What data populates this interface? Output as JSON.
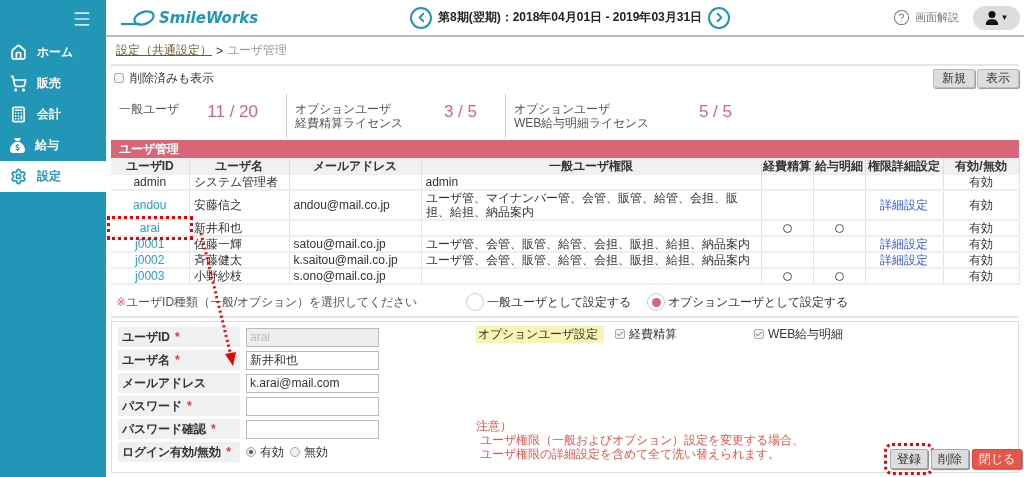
{
  "sidebar": {
    "items": [
      {
        "label": "ホーム",
        "selected": false
      },
      {
        "label": "販売",
        "selected": false
      },
      {
        "label": "会計",
        "selected": false
      },
      {
        "label": "給与",
        "selected": false
      },
      {
        "label": "設定",
        "selected": true
      }
    ]
  },
  "header": {
    "logo": "SmileWorks",
    "period": "第8期(翌期)：2018年04月01日 - 2019年03月31日",
    "help": "画面解説",
    "user_caret": "▼"
  },
  "breadcrumb": {
    "link": "設定（共通設定）",
    "separator": ">",
    "current": "ユーザ管理"
  },
  "show_deleted": {
    "label": "削除済みも表示",
    "checked": false
  },
  "toolbar_buttons": [
    "新規",
    "表示"
  ],
  "licenses": [
    {
      "lines": [
        "一般ユーザ"
      ],
      "count": "11 / 20"
    },
    {
      "lines": [
        "オプションユーザ",
        "経費精算ライセンス"
      ],
      "count": "3 / 5"
    },
    {
      "lines": [
        "オプションユーザ",
        "WEB給与明細ライセンス"
      ],
      "count": "5 / 5"
    }
  ],
  "table": {
    "title": "ユーザ管理",
    "columns": [
      "ユーザID",
      "ユーザ名",
      "メールアドレス",
      "一般ユーザ権限",
      "経費精算",
      "給与明細",
      "権限詳細設定",
      "有効/無効"
    ],
    "rows": [
      {
        "id": "admin",
        "name": "システム管理者",
        "permissions": "admin",
        "expense": false,
        "payslip": false,
        "status": "有効",
        "annotated": false
      },
      {
        "id": "andou",
        "name": "安藤信之",
        "email": "andou@mail.co.jp",
        "permissions": "ユーザ管、マイナンバー管、会管、販管、給管、会担、販担、給担、納品案内",
        "expense": false,
        "payslip": false,
        "detail": "詳細設定",
        "status": "有効",
        "annotated": false
      },
      {
        "id": "arai",
        "name": "新井和也",
        "expense": true,
        "payslip": true,
        "status": "有効",
        "annotated": true
      },
      {
        "id": "j0001",
        "name": "佐藤一輝",
        "email": "satou@mail.co.jp",
        "permissions": "ユーザ管、会管、販管、給管、会担、販担、給担、納品案内",
        "expense": false,
        "payslip": false,
        "detail": "詳細設定",
        "status": "有効",
        "annotated": false
      },
      {
        "id": "j0002",
        "name": "斉藤健太",
        "email": "k.saitou@mail.co.jp",
        "permissions": "ユーザ管、会管、販管、給管、会担、販担、給担、納品案内",
        "expense": false,
        "payslip": false,
        "detail": "詳細設定",
        "status": "有効",
        "annotated": false
      },
      {
        "id": "j0003",
        "name": "小野紗枝",
        "email": "s.ono@mail.co.jp",
        "expense": true,
        "payslip": true,
        "status": "有効",
        "annotated": false
      }
    ]
  },
  "user_type": {
    "note_mark": "※",
    "note": "ユーザID種類（一般/オプション）を選択してください",
    "options": [
      {
        "label": "一般ユーザとして設定する",
        "selected": false
      },
      {
        "label": "オプションユーザとして設定する",
        "selected": true
      }
    ]
  },
  "form": {
    "fields": [
      {
        "kind": "input",
        "label": "ユーザID",
        "mark": "*",
        "value": "arai",
        "disabled": true
      },
      {
        "kind": "input",
        "label": "ユーザ名",
        "mark": "*",
        "value": "新井和也",
        "disabled": false
      },
      {
        "kind": "input",
        "label": "メールアドレス",
        "value": "k.arai@mail.com",
        "disabled": false
      },
      {
        "kind": "input",
        "label": "パスワード",
        "mark": "*",
        "disabled": false
      },
      {
        "kind": "input",
        "label": "パスワード確認",
        "mark": "*",
        "disabled": false
      },
      {
        "kind": "radio",
        "label": "ログイン有効/無効",
        "mark": "*",
        "options": [
          {
            "label": "有効",
            "selected": true
          },
          {
            "label": "無効",
            "selected": false
          }
        ]
      }
    ]
  },
  "option_settings": {
    "label": "オプションユーザ設定",
    "options": [
      {
        "label": "経費精算",
        "checked": true
      },
      {
        "label": "WEB給与明細",
        "checked": true
      }
    ]
  },
  "notice": {
    "title": "注意）",
    "lines": [
      "ユーザ権限（一般およびオプション）設定を変更する場合、",
      "ユーザ権限の詳細設定を含めて全て洗い替えられます。"
    ]
  },
  "actions": [
    {
      "label": "登録",
      "kind": "default",
      "annotated": true
    },
    {
      "label": "削除",
      "kind": "default",
      "annotated": false
    },
    {
      "label": "閉じる",
      "kind": "danger",
      "annotated": false
    }
  ]
}
